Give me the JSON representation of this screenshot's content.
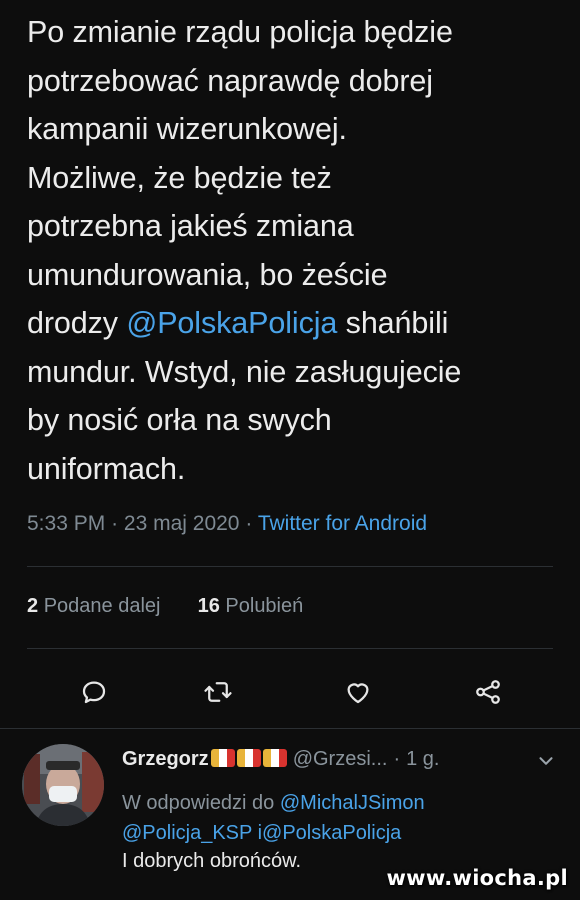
{
  "tweet": {
    "lines": [
      "Po zmianie rządu policja będzie",
      "potrzebować naprawdę dobrej",
      "kampanii wizerunkowej.",
      "Możliwe, że będzie też",
      "potrzebna jakieś zmiana",
      "umundurowania, bo żeście",
      "drodzy ",
      "@PolskaPolicja",
      " shańbili",
      "mundur. Wstyd, nie zasługujecie",
      "by nosić orła na swych",
      "uniformach."
    ],
    "time": "5:33 PM",
    "sep": "·",
    "date": "23 maj 2020",
    "source": "Twitter for Android"
  },
  "stats": {
    "retweets_count": "2",
    "retweets_label": "Podane dalej",
    "likes_count": "16",
    "likes_label": "Polubień"
  },
  "actions": [
    "reply-icon",
    "retweet-icon",
    "like-icon",
    "share-icon"
  ],
  "reply": {
    "name": "Grzegorz",
    "handle": "@Grzesi...",
    "sep": "·",
    "time": "1 g.",
    "reply_to_prefix": "W odpowiedzi do",
    "reply_to_1": "@MichalJSimon",
    "reply_to_2": "@Policja_KSP",
    "reply_to_join": "i",
    "reply_to_3": "@PolskaPolicja",
    "text": "I dobrych obrońców."
  },
  "watermark": "www.wiocha.pl",
  "colors": {
    "background": "#0d0d0d",
    "link": "#4aa3e8",
    "muted": "#8a949c",
    "flag": [
      "#e8b43a",
      "#ffffff",
      "#d8332f"
    ]
  }
}
